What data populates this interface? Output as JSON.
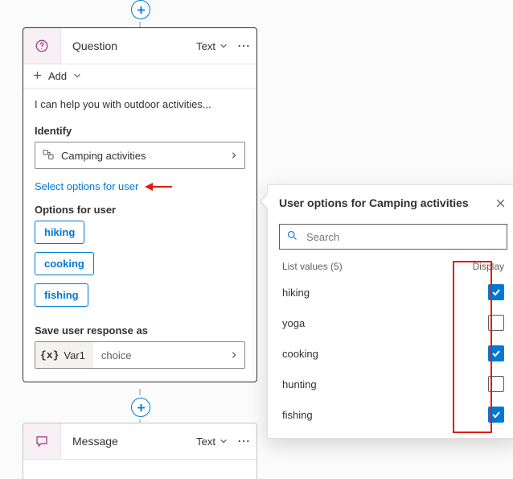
{
  "question_card": {
    "title": "Question",
    "type_label": "Text",
    "add_label": "Add",
    "prompt": "I can help you with outdoor activities...",
    "identify_label": "Identify",
    "identify_value": "Camping activities",
    "select_options_link": "Select options for user",
    "options_for_user_label": "Options for user",
    "options": [
      "hiking",
      "cooking",
      "fishing"
    ],
    "save_response_label": "Save user response as",
    "variable_name": "Var1",
    "variable_type": "choice"
  },
  "message_card": {
    "title": "Message",
    "type_label": "Text"
  },
  "popover": {
    "title": "User options for Camping activities",
    "search_placeholder": "Search",
    "list_values_label": "List values (5)",
    "display_label": "Display",
    "items": [
      {
        "label": "hiking",
        "checked": true
      },
      {
        "label": "yoga",
        "checked": false
      },
      {
        "label": "cooking",
        "checked": true
      },
      {
        "label": "hunting",
        "checked": false
      },
      {
        "label": "fishing",
        "checked": true
      }
    ]
  }
}
